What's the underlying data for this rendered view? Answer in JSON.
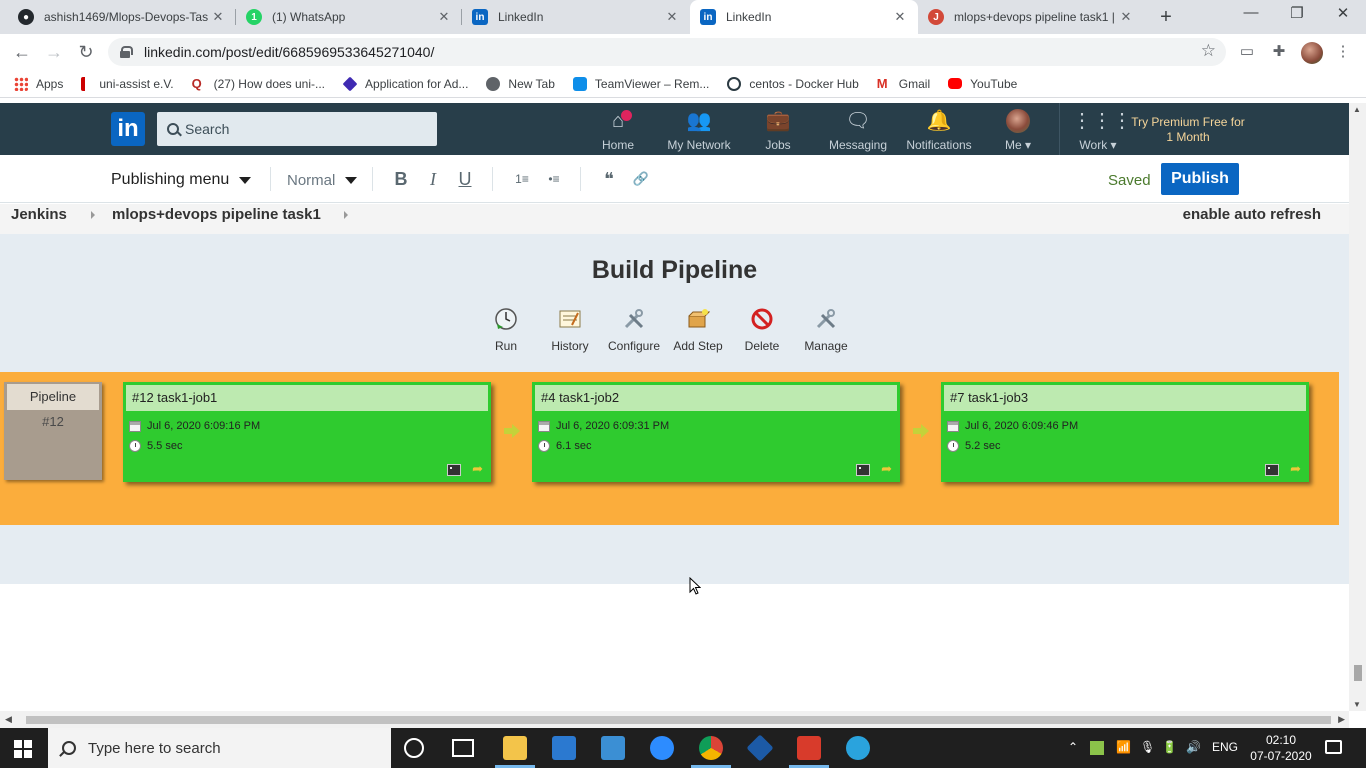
{
  "browser": {
    "tabs": [
      {
        "title": "ashish1469/Mlops-Devops-Tas",
        "favicon": "github-icon",
        "active": false
      },
      {
        "title": "(1) WhatsApp",
        "favicon": "whatsapp-icon",
        "active": false
      },
      {
        "title": "LinkedIn",
        "favicon": "linkedin-icon",
        "active": false
      },
      {
        "title": "LinkedIn",
        "favicon": "linkedin-icon",
        "active": true
      },
      {
        "title": "mlops+devops pipeline task1 |",
        "favicon": "jenkins-icon",
        "active": false
      }
    ],
    "new_tab": "+",
    "window_controls": {
      "minimize": "—",
      "restore": "❐",
      "close": "✕"
    },
    "nav": {
      "back": "←",
      "forward": "→",
      "reload": "↻"
    },
    "url": "linkedin.com/post/edit/6685969533645271040/",
    "bookmarks": [
      {
        "label": "Apps",
        "icon": "apps-grid-icon"
      },
      {
        "label": "uni-assist e.V.",
        "icon": "uni-assist-icon"
      },
      {
        "label": "(27) How does uni-...",
        "icon": "quora-icon"
      },
      {
        "label": "Application for Ad...",
        "icon": "application-icon"
      },
      {
        "label": "New Tab",
        "icon": "globe-icon"
      },
      {
        "label": "TeamViewer – Rem...",
        "icon": "teamviewer-icon"
      },
      {
        "label": "centos - Docker Hub",
        "icon": "docker-icon"
      },
      {
        "label": "Gmail",
        "icon": "gmail-icon"
      },
      {
        "label": "YouTube",
        "icon": "youtube-icon"
      }
    ]
  },
  "linkedin": {
    "search_placeholder": "Search",
    "nav": [
      {
        "label": "Home",
        "icon": "home-icon"
      },
      {
        "label": "My Network",
        "icon": "network-icon"
      },
      {
        "label": "Jobs",
        "icon": "briefcase-icon"
      },
      {
        "label": "Messaging",
        "icon": "messaging-icon"
      },
      {
        "label": "Notifications",
        "icon": "bell-icon"
      },
      {
        "label": "Me",
        "icon": "avatar"
      },
      {
        "label": "Work",
        "icon": "grid-icon"
      }
    ],
    "premium": "Try Premium Free for 1 Month",
    "colors": {
      "header": "#283e4a",
      "publish": "#0a66c2",
      "saved": "#4b7a2d"
    }
  },
  "editor": {
    "publishing_menu": "Publishing menu",
    "style": "Normal",
    "format_buttons": [
      {
        "label": "B",
        "name": "bold-button"
      },
      {
        "label": "I",
        "name": "italic-button"
      },
      {
        "label": "U",
        "name": "underline-button"
      },
      {
        "label": "1≡",
        "name": "numbered-list-button"
      },
      {
        "label": "•≡",
        "name": "bulleted-list-button"
      },
      {
        "label": "❝",
        "name": "quote-button"
      },
      {
        "label": "🔗",
        "name": "link-button"
      }
    ],
    "saved": "Saved",
    "publish": "Publish"
  },
  "jenkins": {
    "breadcrumb": [
      "Jenkins",
      "mlops+devops pipeline task1"
    ],
    "auto_refresh": "enable auto refresh",
    "title": "Build Pipeline",
    "actions": [
      {
        "label": "Run",
        "icon": "run-icon"
      },
      {
        "label": "History",
        "icon": "history-icon"
      },
      {
        "label": "Configure",
        "icon": "configure-icon"
      },
      {
        "label": "Add Step",
        "icon": "add-step-icon"
      },
      {
        "label": "Delete",
        "icon": "delete-icon"
      },
      {
        "label": "Manage",
        "icon": "manage-icon"
      }
    ],
    "pipeline": {
      "label": "Pipeline",
      "number": "#12"
    },
    "jobs": [
      {
        "title": "#12 task1-job1",
        "date": "Jul 6, 2020 6:09:16 PM",
        "duration": "5.5 sec"
      },
      {
        "title": "#4 task1-job2",
        "date": "Jul 6, 2020 6:09:31 PM",
        "duration": "6.1 sec"
      },
      {
        "title": "#7 task1-job3",
        "date": "Jul 6, 2020 6:09:46 PM",
        "duration": "5.2 sec"
      }
    ],
    "colors": {
      "band": "#fbad3c",
      "success": "#2fcb2f",
      "header": "#bdeab0"
    }
  },
  "taskbar": {
    "search_placeholder": "Type here to search",
    "language": "ENG",
    "time": "02:10",
    "date": "07-07-2020"
  }
}
